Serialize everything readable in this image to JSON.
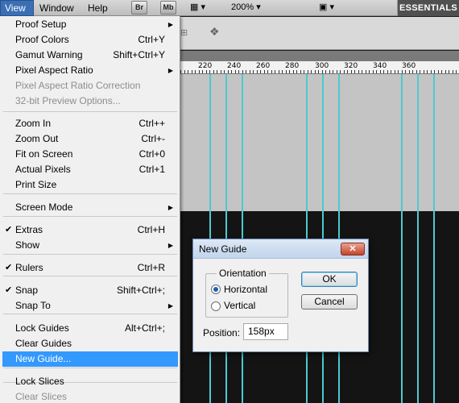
{
  "menubar": {
    "view": "View",
    "window": "Window",
    "help": "Help",
    "badge_br": "Br",
    "badge_mb": "Mb",
    "zoom": "200%",
    "workspace": "ESSENTIALS"
  },
  "ruler": {
    "ticks": [
      "220",
      "240",
      "260",
      "280",
      "300",
      "320",
      "340",
      "360"
    ]
  },
  "view_menu": {
    "items": [
      {
        "label": "Proof Setup",
        "shortcut": "",
        "submenu": true
      },
      {
        "label": "Proof Colors",
        "shortcut": "Ctrl+Y"
      },
      {
        "label": "Gamut Warning",
        "shortcut": "Shift+Ctrl+Y"
      },
      {
        "label": "Pixel Aspect Ratio",
        "shortcut": "",
        "submenu": true
      },
      {
        "label": "Pixel Aspect Ratio Correction",
        "shortcut": "",
        "disabled": true
      },
      {
        "label": "32-bit Preview Options...",
        "shortcut": "",
        "disabled": true
      },
      {
        "label": "Zoom In",
        "shortcut": "Ctrl++"
      },
      {
        "label": "Zoom Out",
        "shortcut": "Ctrl+-"
      },
      {
        "label": "Fit on Screen",
        "shortcut": "Ctrl+0"
      },
      {
        "label": "Actual Pixels",
        "shortcut": "Ctrl+1"
      },
      {
        "label": "Print Size",
        "shortcut": ""
      },
      {
        "label": "Screen Mode",
        "shortcut": "",
        "submenu": true
      },
      {
        "label": "Extras",
        "shortcut": "Ctrl+H",
        "checked": true
      },
      {
        "label": "Show",
        "shortcut": "",
        "submenu": true
      },
      {
        "label": "Rulers",
        "shortcut": "Ctrl+R",
        "checked": true
      },
      {
        "label": "Snap",
        "shortcut": "Shift+Ctrl+;",
        "checked": true
      },
      {
        "label": "Snap To",
        "shortcut": "",
        "submenu": true
      },
      {
        "label": "Lock Guides",
        "shortcut": "Alt+Ctrl+;"
      },
      {
        "label": "Clear Guides",
        "shortcut": ""
      },
      {
        "label": "New Guide...",
        "shortcut": "",
        "selected": true
      },
      {
        "label": "Lock Slices",
        "shortcut": ""
      },
      {
        "label": "Clear Slices",
        "shortcut": "",
        "disabled": true
      }
    ]
  },
  "dialog": {
    "title": "New Guide",
    "close_glyph": "✕",
    "orientation_legend": "Orientation",
    "horizontal_label": "Horizontal",
    "vertical_label": "Vertical",
    "selected_orientation": "Horizontal",
    "ok_label": "OK",
    "cancel_label": "Cancel",
    "position_label": "Position:",
    "position_value": "158px"
  },
  "colors": {
    "guide": "#4ec8d2",
    "menu_selected": "#3399ff",
    "canvas_dark": "#141414",
    "pasteboard": "#c4c4c4"
  }
}
